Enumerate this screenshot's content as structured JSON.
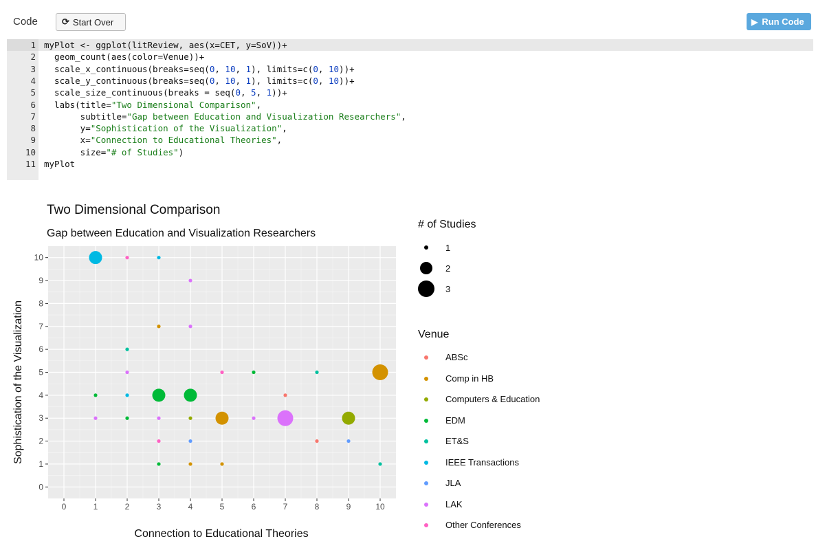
{
  "toolbar": {
    "code_label": "Code",
    "start_over_label": "Start Over",
    "run_code_label": "Run Code"
  },
  "editor": {
    "active_line": 1,
    "lines": [
      {
        "num": "1",
        "text": "myPlot <- ggplot(litReview, aes(x=CET, y=SoV))+"
      },
      {
        "num": "2",
        "text": "  geom_count(aes(color=Venue))+"
      },
      {
        "num": "3",
        "text": "  scale_x_continuous(breaks=seq(0, 10, 1), limits=c(0, 10))+"
      },
      {
        "num": "4",
        "text": "  scale_y_continuous(breaks=seq(0, 10, 1), limits=c(0, 10))+"
      },
      {
        "num": "5",
        "text": "  scale_size_continuous(breaks = seq(0, 5, 1))+"
      },
      {
        "num": "6",
        "text": "  labs(title=\"Two Dimensional Comparison\","
      },
      {
        "num": "7",
        "text": "       subtitle=\"Gap between Education and Visualization Researchers\","
      },
      {
        "num": "8",
        "text": "       y=\"Sophistication of the Visualization\","
      },
      {
        "num": "9",
        "text": "       x=\"Connection to Educational Theories\","
      },
      {
        "num": "10",
        "text": "       size=\"# of Studies\")"
      },
      {
        "num": "11",
        "text": "myPlot"
      }
    ]
  },
  "chart_data": {
    "type": "scatter",
    "title": "Two Dimensional Comparison",
    "subtitle": "Gap between Education and Visualization Researchers",
    "xlabel": "Connection to Educational Theories",
    "ylabel": "Sophistication of the Visualization",
    "xlim": [
      0,
      10
    ],
    "ylim": [
      0,
      10
    ],
    "x_ticks": [
      "0",
      "1",
      "2",
      "3",
      "4",
      "5",
      "6",
      "7",
      "8",
      "9",
      "10"
    ],
    "y_ticks": [
      "0",
      "1",
      "2",
      "3",
      "4",
      "5",
      "6",
      "7",
      "8",
      "9",
      "10"
    ],
    "grid": true,
    "legend_position": "right",
    "size_legend": {
      "title": "# of Studies",
      "levels": [
        {
          "label": "1",
          "value": 1
        },
        {
          "label": "2",
          "value": 2
        },
        {
          "label": "3",
          "value": 3
        }
      ]
    },
    "color_legend": {
      "title": "Venue",
      "entries": [
        {
          "name": "ABSc",
          "color": "#F8766D"
        },
        {
          "name": "Comp in HB",
          "color": "#D39200"
        },
        {
          "name": "Computers & Education",
          "color": "#93AA00"
        },
        {
          "name": "EDM",
          "color": "#00BA38"
        },
        {
          "name": "ET&S",
          "color": "#00C19F"
        },
        {
          "name": "IEEE Transactions",
          "color": "#00B9E3"
        },
        {
          "name": "JLA",
          "color": "#619CFF"
        },
        {
          "name": "LAK",
          "color": "#DB72FB"
        },
        {
          "name": "Other Conferences",
          "color": "#FF61C3"
        }
      ]
    },
    "points": [
      {
        "x": 1,
        "y": 10,
        "venue": "IEEE Transactions",
        "count": 2
      },
      {
        "x": 2,
        "y": 10,
        "venue": "Other Conferences",
        "count": 1
      },
      {
        "x": 3,
        "y": 10,
        "venue": "IEEE Transactions",
        "count": 1
      },
      {
        "x": 4,
        "y": 9,
        "venue": "LAK",
        "count": 1
      },
      {
        "x": 3,
        "y": 7,
        "venue": "Comp in HB",
        "count": 1
      },
      {
        "x": 4,
        "y": 7,
        "venue": "LAK",
        "count": 1
      },
      {
        "x": 2,
        "y": 6,
        "venue": "ET&S",
        "count": 1
      },
      {
        "x": 2,
        "y": 5,
        "venue": "LAK",
        "count": 1
      },
      {
        "x": 5,
        "y": 5,
        "venue": "Other Conferences",
        "count": 1
      },
      {
        "x": 6,
        "y": 5,
        "venue": "EDM",
        "count": 1
      },
      {
        "x": 8,
        "y": 5,
        "venue": "ET&S",
        "count": 1
      },
      {
        "x": 10,
        "y": 5,
        "venue": "Comp in HB",
        "count": 3
      },
      {
        "x": 1,
        "y": 4,
        "venue": "EDM",
        "count": 1
      },
      {
        "x": 2,
        "y": 4,
        "venue": "IEEE Transactions",
        "count": 1
      },
      {
        "x": 3,
        "y": 4,
        "venue": "EDM",
        "count": 2
      },
      {
        "x": 4,
        "y": 4,
        "venue": "EDM",
        "count": 2
      },
      {
        "x": 7,
        "y": 4,
        "venue": "ABSc",
        "count": 1
      },
      {
        "x": 1,
        "y": 3,
        "venue": "LAK",
        "count": 1
      },
      {
        "x": 2,
        "y": 3,
        "venue": "EDM",
        "count": 1
      },
      {
        "x": 3,
        "y": 3,
        "venue": "LAK",
        "count": 1
      },
      {
        "x": 4,
        "y": 3,
        "venue": "Computers & Education",
        "count": 1
      },
      {
        "x": 5,
        "y": 3,
        "venue": "Comp in HB",
        "count": 2
      },
      {
        "x": 6,
        "y": 3,
        "venue": "LAK",
        "count": 1
      },
      {
        "x": 7,
        "y": 3,
        "venue": "LAK",
        "count": 3
      },
      {
        "x": 9,
        "y": 3,
        "venue": "Computers & Education",
        "count": 2
      },
      {
        "x": 3,
        "y": 2,
        "venue": "Other Conferences",
        "count": 1
      },
      {
        "x": 4,
        "y": 2,
        "venue": "JLA",
        "count": 1
      },
      {
        "x": 8,
        "y": 2,
        "venue": "ABSc",
        "count": 1
      },
      {
        "x": 9,
        "y": 2,
        "venue": "JLA",
        "count": 1
      },
      {
        "x": 3,
        "y": 1,
        "venue": "EDM",
        "count": 1
      },
      {
        "x": 4,
        "y": 1,
        "venue": "Comp in HB",
        "count": 1
      },
      {
        "x": 5,
        "y": 1,
        "venue": "Comp in HB",
        "count": 1
      },
      {
        "x": 10,
        "y": 1,
        "venue": "ET&S",
        "count": 1
      }
    ]
  }
}
